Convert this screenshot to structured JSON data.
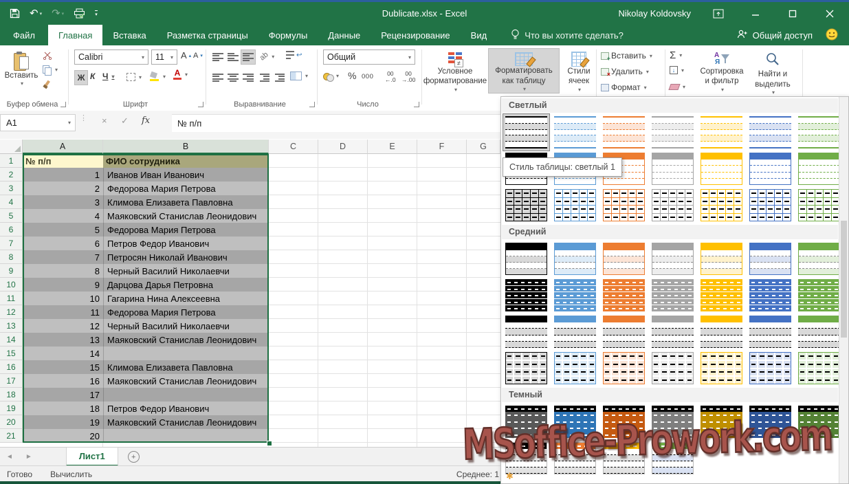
{
  "colors": {
    "excel_green": "#217346",
    "top_strip_blue": "#2c5f9e",
    "selection_green": "#1d6f42",
    "band_dark": "#a6a6a6",
    "band_light": "#bfbfbf",
    "header_a_bg": "#fef7cd",
    "header_b_bg": "#a9a77c"
  },
  "titlebar": {
    "title": "Dublicate.xlsx  -  Excel",
    "user": "Nikolay Koldovsky"
  },
  "tabs": {
    "items": [
      "Файл",
      "Главная",
      "Вставка",
      "Разметка страницы",
      "Формулы",
      "Данные",
      "Рецензирование",
      "Вид"
    ],
    "active": "Главная",
    "tellme": "Что вы хотите сделать?",
    "share": "Общий доступ"
  },
  "ribbon": {
    "paste": "Вставить",
    "clipboard_label": "Буфер обмена",
    "font_label": "Шрифт",
    "font_name": "Calibri",
    "font_size": "11",
    "align_label": "Выравнивание",
    "number_label": "Число",
    "number_format": "Общий",
    "cond_format": "Условное форматирование",
    "format_as_table": "Форматировать как таблицу",
    "cell_styles": "Стили ячеек",
    "insert": "Вставить",
    "delete": "Удалить",
    "format": "Формат",
    "sort_filter": "Сортировка и фильтр",
    "find_select": "Найти и выделить"
  },
  "glyphs": {
    "bold": "Ж",
    "italic": "К",
    "underline": "Ч",
    "sigma": "Σ",
    "percent": "%",
    "thousands": "000",
    "fx": "fx",
    "letterA": "А",
    "caret": "▾",
    "up": "▴",
    "down": "▾",
    "check": "✓",
    "cross": "×",
    "wrap": "↩",
    "orient": "ab",
    "arrow_down": "↓",
    "plus": "+",
    "dec_inc": "←.0",
    "dec_dec": "→.00",
    "num00": "00",
    "star": "✱",
    "notequal": "≠",
    "nav_left": "◄",
    "nav_right": "►"
  },
  "formula_bar": {
    "name_box": "A1",
    "formula": "№ п/п"
  },
  "sheet": {
    "columns": [
      "A",
      "B",
      "C",
      "D",
      "E",
      "F",
      "G"
    ],
    "header": {
      "a": "№ п/п",
      "b": "ФИО сотрудника"
    },
    "rows": [
      {
        "n": "1",
        "name": "Иванов Иван Иванович"
      },
      {
        "n": "2",
        "name": "Федорова Мария Петрова"
      },
      {
        "n": "3",
        "name": "Климова Елизавета Павловна"
      },
      {
        "n": "4",
        "name": "Маяковский Станислав Леонидович"
      },
      {
        "n": "5",
        "name": "Федорова Мария Петрова"
      },
      {
        "n": "6",
        "name": "Петров Федор Иванович"
      },
      {
        "n": "7",
        "name": "Петросян Николай Иванович"
      },
      {
        "n": "8",
        "name": "Черный Василий Николаевчи"
      },
      {
        "n": "9",
        "name": "Дарцова Дарья Петровна"
      },
      {
        "n": "10",
        "name": "Гагарина Нина Алексеевна"
      },
      {
        "n": "11",
        "name": "Федорова Мария Петрова"
      },
      {
        "n": "12",
        "name": "Черный Василий Николаевчи"
      },
      {
        "n": "13",
        "name": "Маяковский Станислав Леонидович"
      },
      {
        "n": "14",
        "name": ""
      },
      {
        "n": "15",
        "name": "Климова Елизавета Павловна"
      },
      {
        "n": "16",
        "name": "Маяковский Станислав Леонидович"
      },
      {
        "n": "17",
        "name": ""
      },
      {
        "n": "18",
        "name": "Петров Федор Иванович"
      },
      {
        "n": "19",
        "name": "Маяковский Станислав Леонидович"
      },
      {
        "n": "20",
        "name": ""
      }
    ]
  },
  "gallery": {
    "tooltip": "Стиль таблицы: светлый 1",
    "palette": {
      "accents": [
        "#000000",
        "#5b9bd5",
        "#ed7d31",
        "#a5a5a5",
        "#ffc000",
        "#4472c4",
        "#70ad47"
      ],
      "bands": [
        "#d9d9d9",
        "#ddebf7",
        "#fce4d6",
        "#ededed",
        "#fff2cc",
        "#d9e1f2",
        "#e2efda"
      ],
      "dark": [
        "#595959",
        "#2e75b6",
        "#c55a11",
        "#7f7f7f",
        "#bf8f00",
        "#2f5597",
        "#548235"
      ],
      "dark2": [
        "#000000",
        "#ed7d31",
        "#ffc000",
        "#70ad47"
      ],
      "dark2_bands": [
        "#e2e2e2",
        "#e2e2e2",
        "#e2e2e2",
        "#d9e1f2"
      ]
    },
    "sections": [
      {
        "label": "Светлый",
        "rows": [
          {
            "variant": "l1",
            "n": 7,
            "selected": 0
          },
          {
            "variant": "l2",
            "n": 7
          },
          {
            "variant": "l3",
            "n": 7
          }
        ]
      },
      {
        "label": "Средний",
        "rows": [
          {
            "variant": "m1",
            "n": 7
          },
          {
            "variant": "m2",
            "n": 7
          },
          {
            "variant": "m3",
            "n": 7
          },
          {
            "variant": "m4",
            "n": 7
          }
        ]
      },
      {
        "label": "Темный",
        "rows": [
          {
            "variant": "d1",
            "n": 7
          },
          {
            "variant": "d2",
            "n": 4
          }
        ]
      }
    ]
  },
  "sheet_tabs": {
    "active": "Лист1"
  },
  "status": {
    "ready": "Готово",
    "calc": "Вычислить",
    "right": "Среднее: 1"
  },
  "watermark": "MSoffice-Prowork.com"
}
